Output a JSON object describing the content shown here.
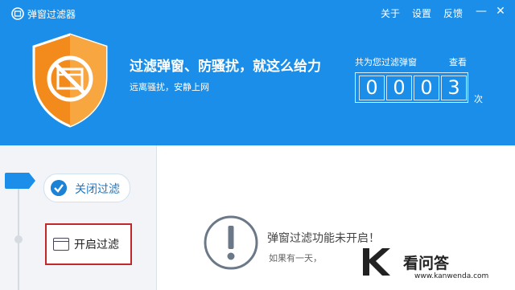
{
  "app": {
    "title": "弹窗过滤器",
    "logo_icon": "app-logo-icon"
  },
  "menu": [
    {
      "label": "关于"
    },
    {
      "label": "设置"
    },
    {
      "label": "反馈"
    }
  ],
  "window_controls": {
    "minimize": "—",
    "close": "✕"
  },
  "header": {
    "slogan": "过滤弹窗、防骚扰，就这么给力",
    "subtitle": "远离骚扰，安静上网",
    "count_label": "共为您过滤弹窗",
    "view_link": "查看",
    "digits": [
      "0",
      "0",
      "0",
      "3"
    ],
    "times_unit": "次",
    "shield_icon": "no-popup-shield-icon"
  },
  "sidebar": {
    "close_filter": "关闭过滤",
    "open_filter": "开启过滤"
  },
  "main": {
    "notice": "弹窗过滤功能未开启！",
    "notice_sub": "如果有一天，"
  },
  "watermark": {
    "text": "看问答",
    "url": "www.kanwenda.com"
  },
  "colors": {
    "header_bg": "#1a8ee8",
    "shield_orange": "#f28b1c",
    "accent": "#1b82d6",
    "highlight_border": "#c0282c"
  }
}
